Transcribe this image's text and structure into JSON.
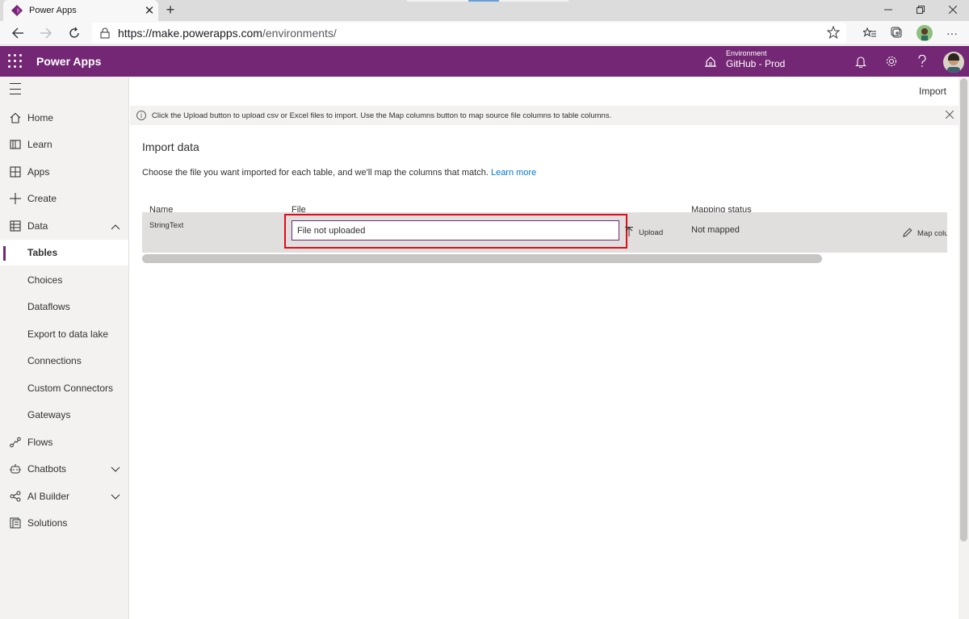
{
  "browser": {
    "tab_title": "Power Apps",
    "tab_close": "✕",
    "new_tab": "+",
    "url_host": "https://make.powerapps.com",
    "url_path": "/environments/",
    "more": "···"
  },
  "header": {
    "app_name": "Power Apps",
    "environment_label": "Environment",
    "environment_name": "GitHub - Prod",
    "accent_color": "#742774"
  },
  "sidebar": {
    "items": [
      {
        "label": "Home",
        "icon": "home-icon"
      },
      {
        "label": "Learn",
        "icon": "book-icon"
      },
      {
        "label": "Apps",
        "icon": "apps-icon"
      },
      {
        "label": "Create",
        "icon": "plus-icon"
      },
      {
        "label": "Data",
        "icon": "table-icon",
        "expanded": true
      },
      {
        "label": "Tables",
        "selected": true
      },
      {
        "label": "Choices"
      },
      {
        "label": "Dataflows"
      },
      {
        "label": "Export to data lake"
      },
      {
        "label": "Connections"
      },
      {
        "label": "Custom Connectors"
      },
      {
        "label": "Gateways"
      },
      {
        "label": "Flows",
        "icon": "flow-icon"
      },
      {
        "label": "Chatbots",
        "icon": "bot-icon",
        "expanded": false
      },
      {
        "label": "AI Builder",
        "icon": "ai-builder-icon",
        "expanded": false
      },
      {
        "label": "Solutions",
        "icon": "solutions-icon"
      }
    ]
  },
  "main": {
    "command_title": "Import",
    "info_message": "Click the Upload button to upload csv or Excel files to import. Use the Map columns button to map source file columns to table columns.",
    "title": "Import data",
    "description": "Choose the file you want imported for each table, and we'll map the columns that match.",
    "learn_more": "Learn more",
    "columns": [
      "Name",
      "File",
      "Mapping status"
    ],
    "rows": [
      {
        "name": "StringText",
        "file_value": "File not uploaded",
        "upload_label": "Upload",
        "mapping_status": "Not mapped",
        "map_label": "Map columns"
      }
    ]
  }
}
